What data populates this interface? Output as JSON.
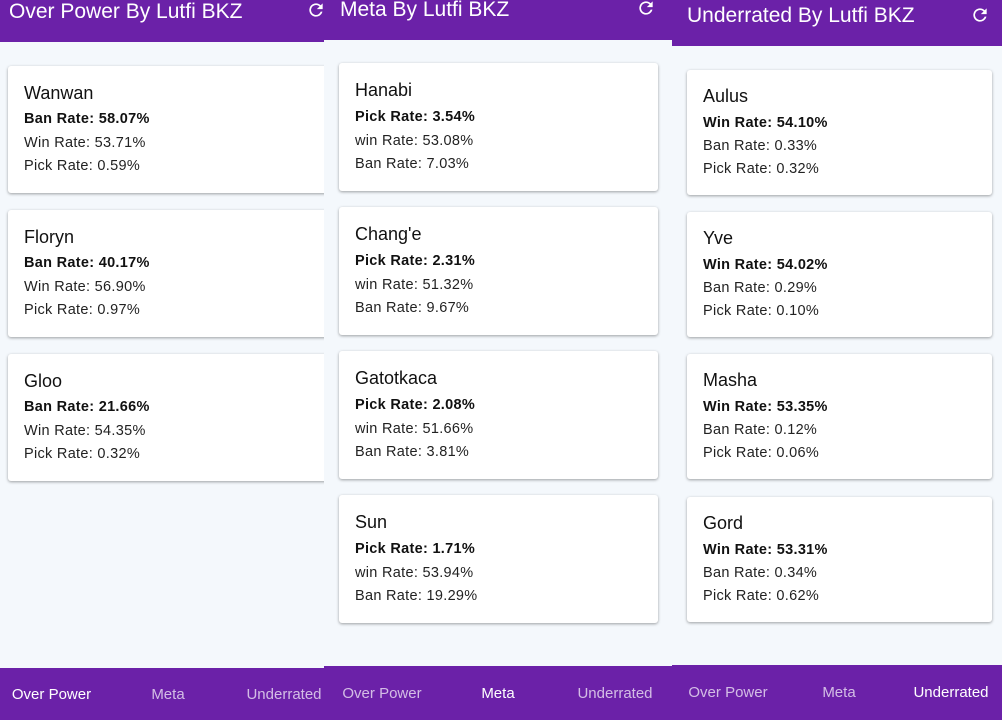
{
  "colors": {
    "primary": "#6b21a8",
    "background": "#f4f8fc",
    "card": "#ffffff"
  },
  "screens": [
    {
      "title": "Over Power By Lutfi BKZ",
      "refresh_icon": "refresh-icon",
      "cards": [
        {
          "name": "Wanwan",
          "primary": "Ban Rate: 58.07%",
          "second": "Win Rate: 53.71%",
          "third": "Pick Rate: 0.59%"
        },
        {
          "name": "Floryn",
          "primary": "Ban Rate: 40.17%",
          "second": "Win Rate: 56.90%",
          "third": "Pick Rate: 0.97%"
        },
        {
          "name": "Gloo",
          "primary": "Ban Rate: 21.66%",
          "second": "Win Rate: 54.35%",
          "third": "Pick Rate: 0.32%"
        }
      ],
      "nav": [
        {
          "label": "Over Power",
          "active": true
        },
        {
          "label": "Meta",
          "active": false
        },
        {
          "label": "Underrated",
          "active": false
        }
      ]
    },
    {
      "title": "Meta By Lutfi BKZ",
      "refresh_icon": "refresh-icon",
      "cards": [
        {
          "name": "Hanabi",
          "primary": "Pick Rate: 3.54%",
          "second": "win Rate: 53.08%",
          "third": "Ban Rate: 7.03%"
        },
        {
          "name": "Chang'e",
          "primary": "Pick Rate: 2.31%",
          "second": "win Rate: 51.32%",
          "third": "Ban Rate: 9.67%"
        },
        {
          "name": "Gatotkaca",
          "primary": "Pick Rate: 2.08%",
          "second": "win Rate: 51.66%",
          "third": "Ban Rate: 3.81%"
        },
        {
          "name": "Sun",
          "primary": "Pick Rate: 1.71%",
          "second": "win Rate: 53.94%",
          "third": "Ban Rate: 19.29%"
        }
      ],
      "nav": [
        {
          "label": "Over Power",
          "active": false
        },
        {
          "label": "Meta",
          "active": true
        },
        {
          "label": "Underrated",
          "active": false
        }
      ]
    },
    {
      "title": "Underrated By Lutfi BKZ",
      "refresh_icon": "refresh-icon",
      "cards": [
        {
          "name": "Aulus",
          "primary": "Win Rate: 54.10%",
          "second": "Ban Rate: 0.33%",
          "third": "Pick Rate: 0.32%"
        },
        {
          "name": "Yve",
          "primary": "Win Rate: 54.02%",
          "second": "Ban Rate: 0.29%",
          "third": "Pick Rate: 0.10%"
        },
        {
          "name": "Masha",
          "primary": "Win Rate: 53.35%",
          "second": "Ban Rate: 0.12%",
          "third": "Pick Rate: 0.06%"
        },
        {
          "name": "Gord",
          "primary": "Win Rate: 53.31%",
          "second": "Ban Rate: 0.34%",
          "third": "Pick Rate: 0.62%"
        }
      ],
      "nav": [
        {
          "label": "Over Power",
          "active": false
        },
        {
          "label": "Meta",
          "active": false
        },
        {
          "label": "Underrated",
          "active": true
        }
      ]
    }
  ]
}
